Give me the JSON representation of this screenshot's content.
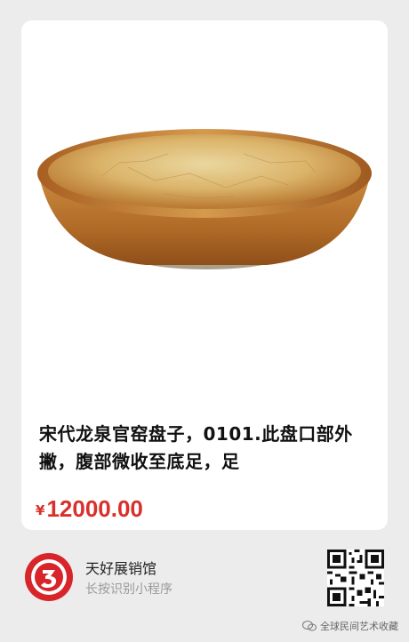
{
  "product": {
    "title": "宋代龙泉官窑盘子，0101.此盘口部外撇，腹部微收至底足，足",
    "currency": "¥",
    "price": "12000.00"
  },
  "footer": {
    "shop_name": "天好展销馆",
    "shop_subtitle": "长按识别小程序",
    "logo_icon": "red-circle-3-logo-icon",
    "qr_icon": "mini-program-qr-code"
  },
  "watermark": {
    "text": "全球民间艺术收藏"
  },
  "colors": {
    "price": "#d9302c",
    "background": "#ececec",
    "card": "#ffffff"
  }
}
